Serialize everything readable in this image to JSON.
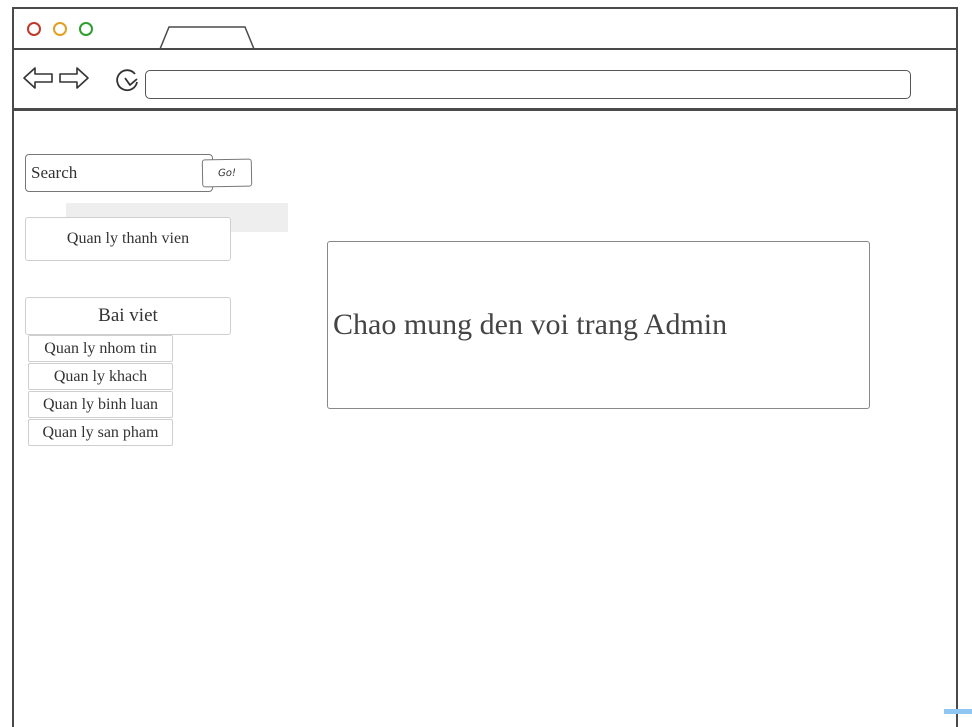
{
  "search": {
    "placeholder": "Search",
    "go_label": "Go!"
  },
  "sidebar": {
    "members_label": "Quan ly thanh vien",
    "posts_label": "Bai viet",
    "sub_items": [
      {
        "label": "Quan ly nhom tin"
      },
      {
        "label": "Quan ly khach"
      },
      {
        "label": "Quan ly binh luan"
      },
      {
        "label": "Quan ly san pham"
      }
    ]
  },
  "main": {
    "welcome": "Chao mung den voi trang Admin"
  },
  "colors": {
    "close_dot": "#c0392b",
    "minimize_dot": "#e0a020",
    "maximize_dot": "#2e9e2e",
    "frame": "#4a4a4a"
  },
  "icons": [
    "back-arrow-icon",
    "forward-arrow-icon",
    "reload-icon"
  ]
}
